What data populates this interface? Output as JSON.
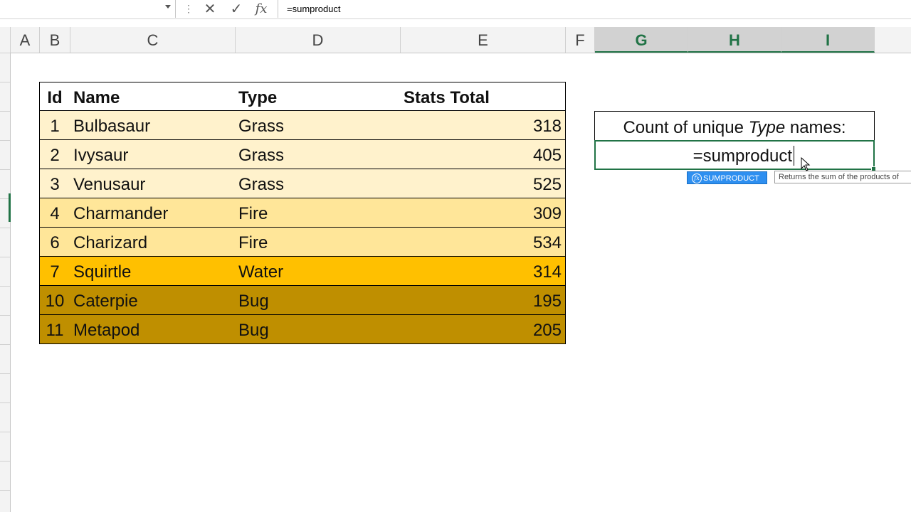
{
  "formula_bar": {
    "name_box": "",
    "formula": "=sumproduct",
    "fx_label": "fx",
    "cancel_icon": "x-icon",
    "enter_icon": "check-icon"
  },
  "columns": [
    "A",
    "B",
    "C",
    "D",
    "E",
    "F",
    "G",
    "H",
    "I"
  ],
  "table": {
    "headers": [
      "Id",
      "Name",
      "Type",
      "Stats Total"
    ],
    "rows": [
      {
        "id": "1",
        "name": "Bulbasaur",
        "type": "Grass",
        "stats": "318",
        "color": "#fff2cc"
      },
      {
        "id": "2",
        "name": "Ivysaur",
        "type": "Grass",
        "stats": "405",
        "color": "#fff2cc"
      },
      {
        "id": "3",
        "name": "Venusaur",
        "type": "Grass",
        "stats": "525",
        "color": "#fff2cc"
      },
      {
        "id": "4",
        "name": "Charmander",
        "type": "Fire",
        "stats": "309",
        "color": "#ffe699"
      },
      {
        "id": "6",
        "name": "Charizard",
        "type": "Fire",
        "stats": "534",
        "color": "#ffe699"
      },
      {
        "id": "7",
        "name": "Squirtle",
        "type": "Water",
        "stats": "314",
        "color": "#ffc000"
      },
      {
        "id": "10",
        "name": "Caterpie",
        "type": "Bug",
        "stats": "195",
        "color": "#bf8f00"
      },
      {
        "id": "11",
        "name": "Metapod",
        "type": "Bug",
        "stats": "205",
        "color": "#bf8f00"
      }
    ]
  },
  "side_box": {
    "label_prefix": "Count of unique",
    "label_emph": "Type",
    "label_suffix": "names:",
    "editing_value": "=sumproduct"
  },
  "autocomplete": {
    "item": "SUMPRODUCT",
    "tooltip": "Returns the sum of the products of"
  }
}
